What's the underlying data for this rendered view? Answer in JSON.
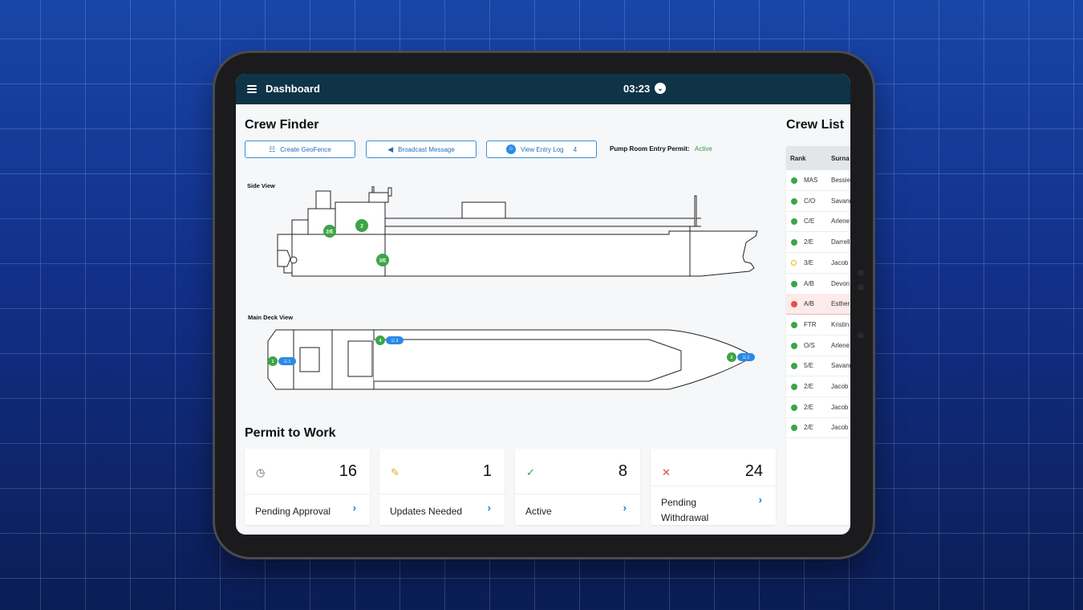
{
  "topbar": {
    "title": "Dashboard",
    "time": "03:23",
    "time_icon": "chevron-down-icon"
  },
  "crew_finder": {
    "title": "Crew Finder",
    "buttons": [
      {
        "label": "Create GeoFence",
        "icon": "geofence-icon"
      },
      {
        "label": "Broadcast Message",
        "icon": "megaphone-icon"
      },
      {
        "label": "View Entry Log",
        "icon": "crew-icon",
        "count": "4"
      }
    ],
    "permit": {
      "label": "Pump Room Entry Permit:",
      "status": "Active"
    },
    "side_view": {
      "label": "Side View",
      "markers": [
        "2/E",
        "2",
        "3/E"
      ]
    },
    "main_deck_view": {
      "label": "Main Deck View",
      "markers": [
        {
          "count": "1",
          "tag": "1"
        },
        {
          "count": "4",
          "tag": "3"
        },
        {
          "count": "2",
          "tag": "1"
        }
      ]
    }
  },
  "permit_to_work": {
    "title": "Permit to Work",
    "cards": [
      {
        "icon": "clock-icon",
        "count": "16",
        "label": "Pending Approval"
      },
      {
        "icon": "edit-icon",
        "count": "1",
        "label": "Updates Needed"
      },
      {
        "icon": "check-icon",
        "count": "8",
        "label": "Active"
      },
      {
        "icon": "close-icon",
        "count": "24",
        "label": "Pending Withdrawal"
      }
    ]
  },
  "crew_list": {
    "title": "Crew List",
    "columns": [
      "Rank",
      "Surna"
    ],
    "rows": [
      {
        "status": "green",
        "rank": "MAS",
        "surname": "Bessie"
      },
      {
        "status": "green",
        "rank": "C/O",
        "surname": "Savann"
      },
      {
        "status": "green",
        "rank": "C/E",
        "surname": "Arlene"
      },
      {
        "status": "green",
        "rank": "2/E",
        "surname": "Darrell"
      },
      {
        "status": "yellow",
        "rank": "3/E",
        "surname": "Jacob"
      },
      {
        "status": "green",
        "rank": "A/B",
        "surname": "Devon"
      },
      {
        "status": "red",
        "rank": "A/B",
        "surname": "Esther"
      },
      {
        "status": "green",
        "rank": "FTR",
        "surname": "Kristin"
      },
      {
        "status": "green",
        "rank": "O/S",
        "surname": "Arlene"
      },
      {
        "status": "green",
        "rank": "5/E",
        "surname": "Savann"
      },
      {
        "status": "green",
        "rank": "2/E",
        "surname": "Jacob"
      },
      {
        "status": "green",
        "rank": "2/E",
        "surname": "Jacob"
      },
      {
        "status": "green",
        "rank": "2/E",
        "surname": "Jacob"
      }
    ]
  },
  "colors": {
    "topbar": "#0f3347",
    "accent": "#1f78c8",
    "active": "#2e9b45",
    "marker_green": "#3da447",
    "marker_blue": "#2b8ae6"
  }
}
